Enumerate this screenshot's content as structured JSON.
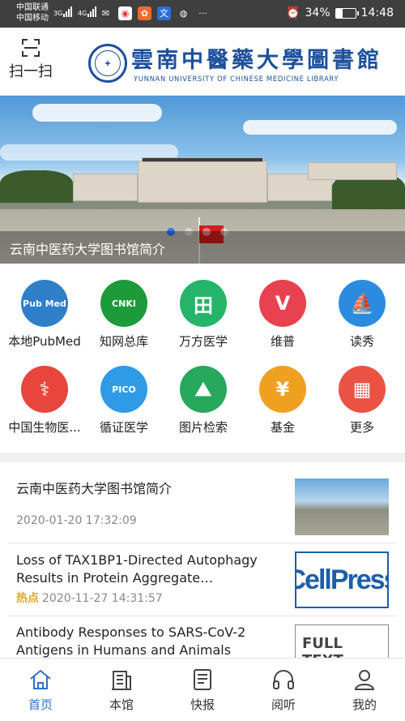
{
  "status_bar": {
    "carrier1": "中国联通",
    "carrier2": "中国移动",
    "net1": "3G",
    "net2": "4G",
    "battery": "34%",
    "battery_level": 0.34,
    "time": "14:48",
    "overflow": "···"
  },
  "header": {
    "scan_label": "扫一扫",
    "library_name": "雲南中醫藥大學圖書館",
    "library_name_en": "YUNNAN UNIVERSITY OF CHINESE MEDICINE LIBRARY"
  },
  "banner": {
    "caption": "云南中医药大学图书馆简介",
    "slide_count": 4,
    "active_slide": 1
  },
  "shortcuts": [
    {
      "label": "本地PubMed",
      "icon": "pubmed-icon",
      "glyph": "Pub Med",
      "color": "#2f7fc8"
    },
    {
      "label": "知网总库",
      "icon": "cnki-icon",
      "glyph": "CNKI",
      "color": "#1d9a3a"
    },
    {
      "label": "万方医学",
      "icon": "wanfang-icon",
      "glyph": "田",
      "color": "#25b46a"
    },
    {
      "label": "维普",
      "icon": "vip-icon",
      "glyph": "V",
      "color": "#e8414f"
    },
    {
      "label": "读秀",
      "icon": "duxiu-sail-icon",
      "glyph": "⛵",
      "color": "#2b8be0"
    },
    {
      "label": "中国生物医...",
      "icon": "sinomed-icon",
      "glyph": "⚕",
      "color": "#e8453c"
    },
    {
      "label": "循证医学",
      "icon": "pico-icon",
      "glyph": "PICO",
      "color": "#2f9be6"
    },
    {
      "label": "图片检索",
      "icon": "image-search-icon",
      "glyph": "⛰",
      "color": "#27a85c"
    },
    {
      "label": "基金",
      "icon": "fund-yen-icon",
      "glyph": "¥",
      "color": "#f0a020"
    },
    {
      "label": "更多",
      "icon": "more-apps-icon",
      "glyph": "▦",
      "color": "#ec5243"
    }
  ],
  "news": [
    {
      "title": "云南中医药大学图书馆简介",
      "hot": "",
      "time": "2020-01-20 17:32:09",
      "thumb": "campus-photo"
    },
    {
      "title": "Loss of TAX1BP1-Directed Autophagy Results in Protein Aggregate…",
      "hot": "热点",
      "time": "2020-11-27 14:31:57",
      "thumb": "CellPress"
    },
    {
      "title": "Antibody Responses to SARS-CoV-2 Antigens in Humans and Animals",
      "hot": "",
      "time": "",
      "thumb": "FULL TEXT MDPI"
    }
  ],
  "tabs": [
    {
      "label": "首页",
      "icon": "home-icon",
      "active": true
    },
    {
      "label": "本馆",
      "icon": "library-building-icon",
      "active": false
    },
    {
      "label": "快报",
      "icon": "newsletter-icon",
      "active": false
    },
    {
      "label": "阅听",
      "icon": "headphones-icon",
      "active": false
    },
    {
      "label": "我的",
      "icon": "profile-icon",
      "active": false
    }
  ],
  "colors": {
    "accent": "#2f6fd1",
    "hot": "#e6a52c",
    "brand": "#1d4f9c"
  }
}
